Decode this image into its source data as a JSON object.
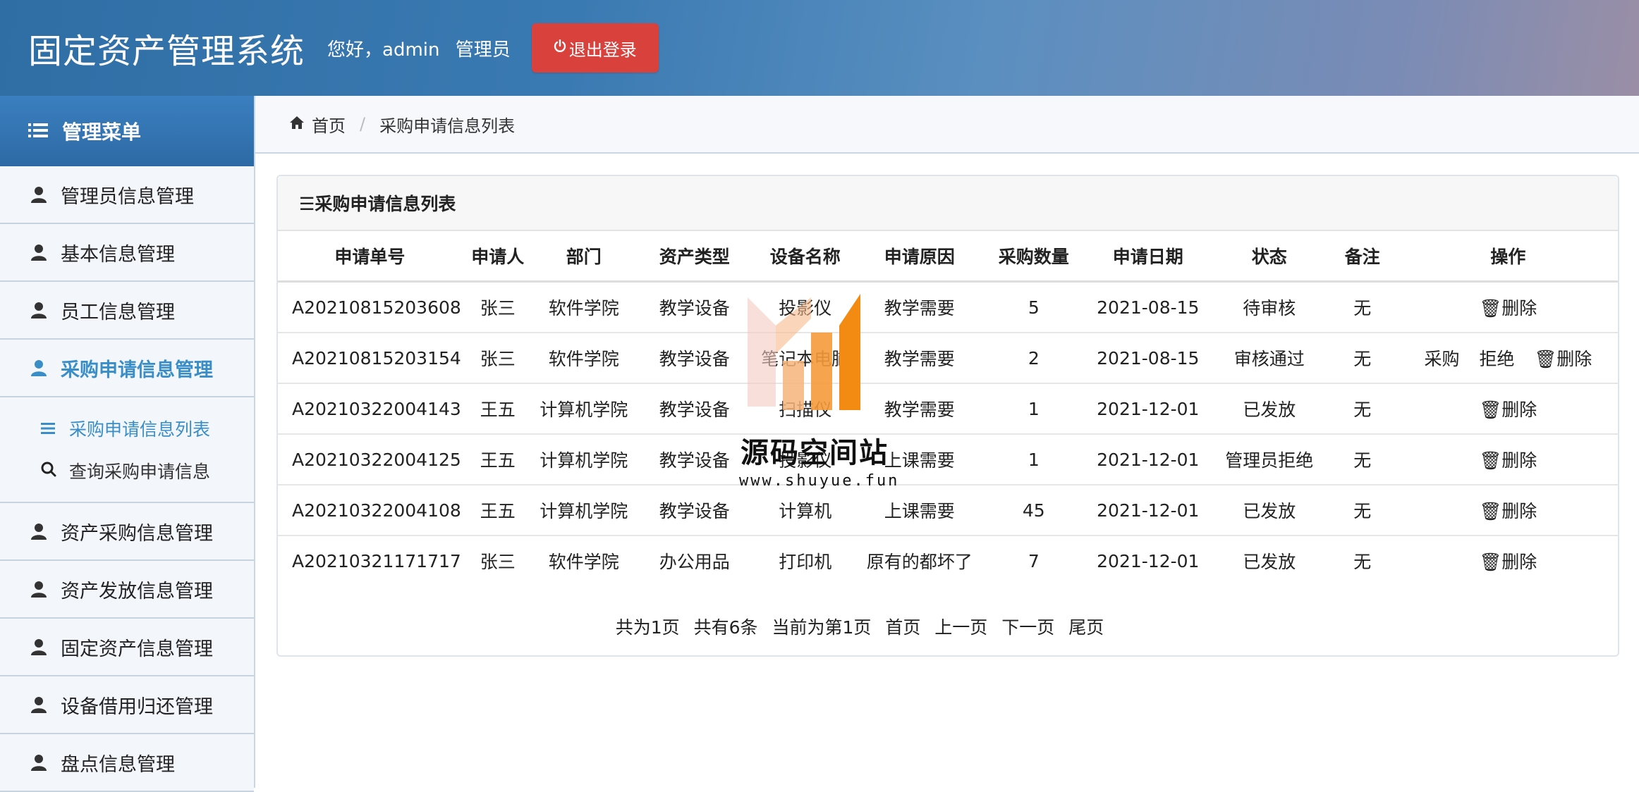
{
  "header": {
    "title": "固定资产管理系统",
    "greeting": "您好，admin",
    "role": "管理员",
    "logout_label": "退出登录",
    "logout_icon": "power-icon"
  },
  "sidebar": {
    "heading": "管理菜单",
    "items": [
      {
        "label": "管理员信息管理"
      },
      {
        "label": "基本信息管理"
      },
      {
        "label": "员工信息管理"
      },
      {
        "label": "采购申请信息管理"
      },
      {
        "label": "资产采购信息管理"
      },
      {
        "label": "资产发放信息管理"
      },
      {
        "label": "固定资产信息管理"
      },
      {
        "label": "设备借用归还管理"
      },
      {
        "label": "盘点信息管理"
      }
    ],
    "submenu": [
      {
        "label": "采购申请信息列表",
        "icon": "list-icon"
      },
      {
        "label": "查询采购申请信息",
        "icon": "search-icon"
      }
    ]
  },
  "breadcrumb": {
    "home": "首页",
    "current": "采购申请信息列表"
  },
  "panel": {
    "title": "☰采购申请信息列表"
  },
  "table": {
    "headers": [
      "申请单号",
      "申请人",
      "部门",
      "资产类型",
      "设备名称",
      "申请原因",
      "采购数量",
      "申请日期",
      "状态",
      "备注",
      "操作"
    ],
    "rows": [
      {
        "id": "A20210815203608",
        "applicant": "张三",
        "dept": "软件学院",
        "type": "教学设备",
        "device": "投影仪",
        "reason": "教学需要",
        "qty": "5",
        "date": "2021-08-15",
        "status": "待审核",
        "note": "无"
      },
      {
        "id": "A20210815203154",
        "applicant": "张三",
        "dept": "软件学院",
        "type": "教学设备",
        "device": "笔记本电脑",
        "reason": "教学需要",
        "qty": "2",
        "date": "2021-08-15",
        "status": "审核通过",
        "note": "无"
      },
      {
        "id": "A20210322004143",
        "applicant": "王五",
        "dept": "计算机学院",
        "type": "教学设备",
        "device": "扫描仪",
        "reason": "教学需要",
        "qty": "1",
        "date": "2021-12-01",
        "status": "已发放",
        "note": "无"
      },
      {
        "id": "A20210322004125",
        "applicant": "王五",
        "dept": "计算机学院",
        "type": "教学设备",
        "device": "投影仪",
        "reason": "上课需要",
        "qty": "1",
        "date": "2021-12-01",
        "status": "管理员拒绝",
        "note": "无"
      },
      {
        "id": "A20210322004108",
        "applicant": "王五",
        "dept": "计算机学院",
        "type": "教学设备",
        "device": "计算机",
        "reason": "上课需要",
        "qty": "45",
        "date": "2021-12-01",
        "status": "已发放",
        "note": "无"
      },
      {
        "id": "A20210321171717",
        "applicant": "张三",
        "dept": "软件学院",
        "type": "办公用品",
        "device": "打印机",
        "reason": "原有的都坏了",
        "qty": "7",
        "date": "2021-12-01",
        "status": "已发放",
        "note": "无"
      }
    ],
    "delete_label": "删除",
    "purchase_label": "采购",
    "reject_label": "拒绝"
  },
  "pager": {
    "total_pages": "共为1页",
    "total_items": "共有6条",
    "current": "当前为第1页",
    "first": "首页",
    "prev": "上一页",
    "next": "下一页",
    "last": "尾页"
  },
  "watermark": {
    "text": "源码空间站",
    "url": "www.shuyue.fun"
  },
  "colors": {
    "accent": "#3a8ec8",
    "logout": "#d9413d",
    "header_start": "#2f6ea5"
  }
}
